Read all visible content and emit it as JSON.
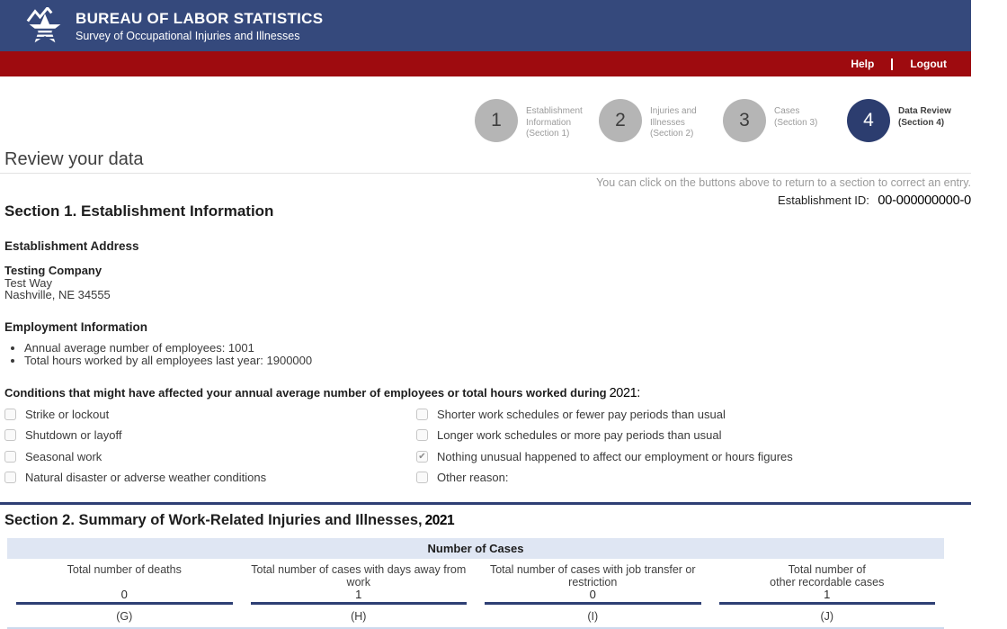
{
  "colors": {
    "header_navy": "#35497c",
    "nav_red": "#9e0b0f",
    "accent_navy": "#2c3d6f",
    "step_gray": "#b5b5b5",
    "table_header_bg": "#dfe6f3",
    "underline_navy": "#2e3f74",
    "light_blue_line": "#ccd9ed"
  },
  "icons": {
    "logo": "bls-star-logo",
    "check": "✔"
  },
  "header": {
    "title": "BUREAU OF LABOR STATISTICS",
    "subtitle": "Survey of Occupational Injuries and Illnesses",
    "nav": {
      "help": "Help",
      "logout": "Logout"
    }
  },
  "steps": [
    {
      "number": "1",
      "label_lines": [
        "Establishment",
        "Information",
        "(Section 1)"
      ],
      "active": false
    },
    {
      "number": "2",
      "label_lines": [
        "Injuries and",
        "Illnesses",
        "(Section 2)"
      ],
      "active": false
    },
    {
      "number": "3",
      "label_lines": [
        "Cases",
        "(Section 3)"
      ],
      "active": false
    },
    {
      "number": "4",
      "label_lines": [
        "Data Review",
        "(Section 4)"
      ],
      "active": true
    }
  ],
  "page": {
    "title": "Review your data",
    "instruction": "You can click on the buttons above to return to a section to correct an entry.",
    "establishment_id_label": "Establishment ID:",
    "establishment_id_value": "00-000000000-0"
  },
  "section1": {
    "heading": "Section 1. Establishment Information",
    "address_heading": "Establishment Address",
    "company": "Testing Company",
    "address_line1": "Test Way",
    "address_line2": "Nashville, NE 34555",
    "employment_heading": "Employment Information",
    "bullets": [
      "Annual average number of employees: 1001",
      "Total hours worked by all employees last year: 1900000"
    ],
    "conditions_heading": "Conditions that might have affected your annual average number of employees or total hours worked during",
    "conditions_year": "2021:",
    "conditions": [
      {
        "label": "Strike or lockout",
        "checked": false
      },
      {
        "label": "Shutdown or layoff",
        "checked": false
      },
      {
        "label": "Seasonal work",
        "checked": false
      },
      {
        "label": "Natural disaster or adverse weather conditions",
        "checked": false
      },
      {
        "label": "Shorter work schedules or fewer pay periods than usual",
        "checked": false
      },
      {
        "label": "Longer work schedules or more pay periods than usual",
        "checked": false
      },
      {
        "label": "Nothing unusual happened to affect our employment or hours figures",
        "checked": true
      },
      {
        "label": "Other reason:",
        "checked": false
      }
    ]
  },
  "section2": {
    "heading": "Section 2. Summary of Work-Related Injuries and Illnesses,",
    "year": "2021",
    "table": {
      "group_header": "Number of Cases",
      "columns": [
        {
          "header_lines": [
            "Total number of deaths"
          ],
          "value": "0",
          "letter": "(G)"
        },
        {
          "header_lines": [
            "Total number of cases with days away from",
            "work"
          ],
          "value": "1",
          "letter": "(H)"
        },
        {
          "header_lines": [
            "Total number of cases with job transfer or",
            "restriction"
          ],
          "value": "0",
          "letter": "(I)"
        },
        {
          "header_lines": [
            "Total number of",
            "other recordable cases"
          ],
          "value": "1",
          "letter": "(J)"
        }
      ]
    }
  }
}
